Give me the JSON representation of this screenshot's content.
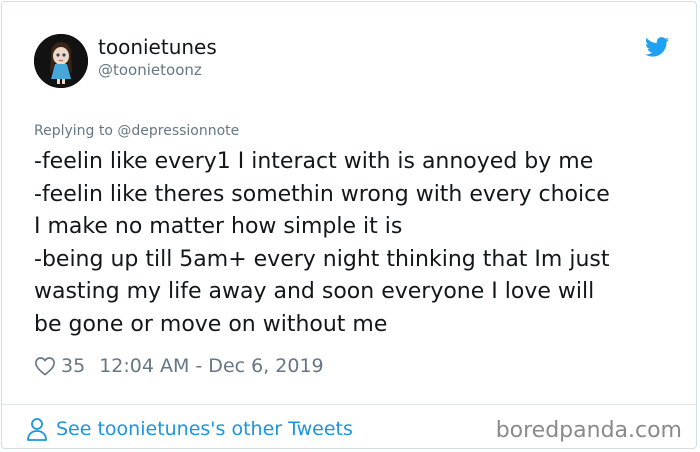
{
  "user": {
    "display_name": "toonietunes",
    "handle": "@toonietoonz"
  },
  "reply": {
    "label": "Replying to @depressionnote"
  },
  "tweet": {
    "lines": [
      "-feelin like every1 I interact with is annoyed by me",
      "-feelin like theres somethin wrong with every choice",
      "I make no matter how simple it is",
      "-being up till 5am+ every night thinking that Im just",
      "wasting my life away and soon everyone I love will",
      "be gone or move on without me"
    ],
    "likes": "35",
    "timestamp": "12:04 AM - Dec 6, 2019"
  },
  "footer": {
    "other_tweets_label": "See toonietunes's other Tweets"
  },
  "watermark": "boredpanda.com",
  "colors": {
    "twitter_blue": "#1da1f2",
    "link_blue": "#1b95e0",
    "muted_text": "#657786",
    "body_text": "#14171a"
  },
  "icons": {
    "brand": "twitter-bird-icon",
    "like": "heart-outline-icon",
    "profile": "person-outline-icon"
  }
}
